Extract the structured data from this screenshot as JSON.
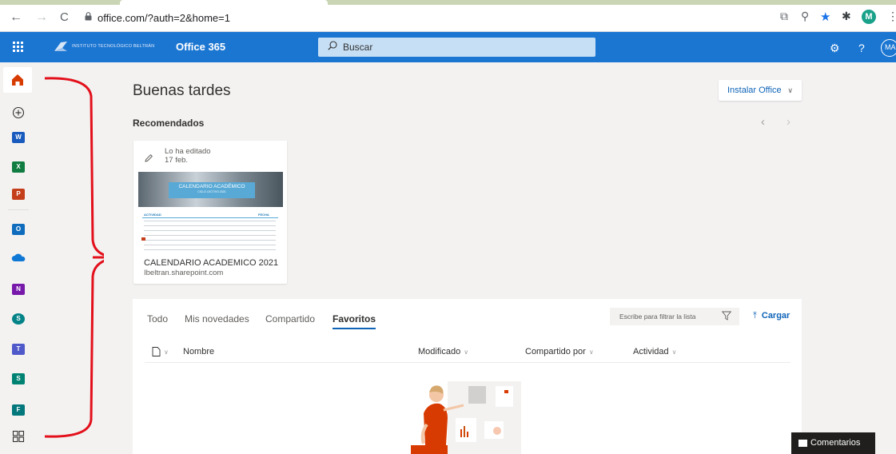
{
  "browser": {
    "url": "office.com/?auth=2&home=1",
    "profile_initial": "M"
  },
  "suite": {
    "org_name": "INSTITUTO TECNOLÓGICO BELTRÁN",
    "app_name": "Office 365",
    "search_placeholder": "Buscar",
    "help_glyph": "?",
    "user_initials": "MA",
    "brand_color": "#1b76d2"
  },
  "rail": {
    "items": [
      "home-icon",
      "create-icon",
      "word-icon",
      "excel-icon",
      "powerpoint-icon",
      "outlook-icon",
      "onedrive-icon",
      "onenote-icon",
      "sharepoint-icon",
      "teams-icon",
      "sway-icon",
      "forms-icon",
      "all-apps-icon"
    ]
  },
  "main": {
    "greeting": "Buenas tardes",
    "install_label": "Instalar Office",
    "recommended_title": "Recomendados",
    "card": {
      "edited_line1": "Lo ha editado",
      "edited_line2": "17 feb.",
      "thumb_title": "CALENDARIO ACADÉMICO",
      "thumb_subtitle": "CICLO LECTIVO 2021",
      "thumb_col1": "ACTIVIDAD",
      "thumb_col2": "FECHA",
      "name": "CALENDARIO ACADEMICO 2021",
      "site": "Ibeltran.sharepoint.com"
    },
    "files": {
      "tabs": [
        "Todo",
        "Mis novedades",
        "Compartido",
        "Favoritos"
      ],
      "active_tab": "Favoritos",
      "filter_placeholder": "Escribe para filtrar la lista",
      "upload_label": "Cargar",
      "columns": [
        "Nombre",
        "Modificado",
        "Compartido por",
        "Actividad"
      ]
    }
  },
  "feedback_label": "Comentarios",
  "annotation_color": "#e3101b"
}
